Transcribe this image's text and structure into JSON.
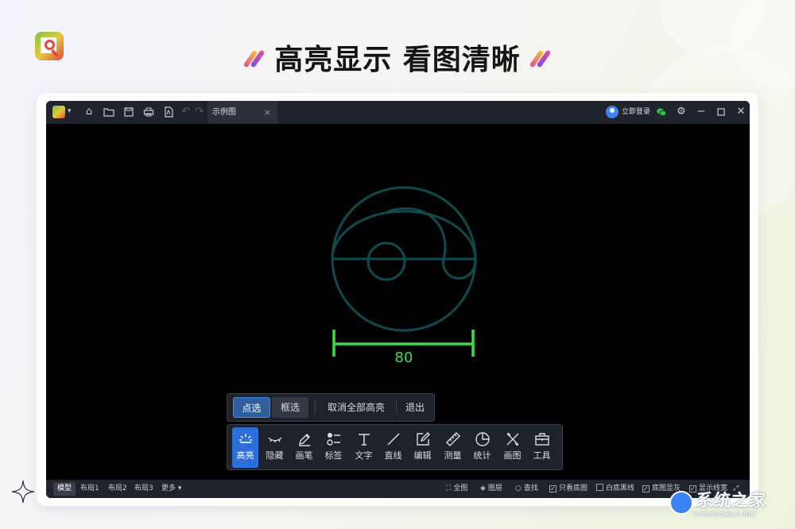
{
  "headline": "高亮显示 看图清晰",
  "titlebar": {
    "tab_label": "示例图",
    "tab_close": "×",
    "login_label": "立即登录",
    "icons": [
      "app-menu-icon",
      "home-icon",
      "open-folder-icon",
      "save-icon",
      "print-icon",
      "pdf-icon",
      "undo-icon",
      "redo-icon"
    ],
    "window_controls": [
      "settings-icon",
      "minimize-icon",
      "maximize-icon",
      "close-icon"
    ]
  },
  "drawing": {
    "dimension_value": "80",
    "line_color": "#0f4a4f",
    "dimension_color": "#3fdc4a"
  },
  "select_bar": {
    "point_select": "点选",
    "box_select": "框选",
    "cancel_all": "取消全部高亮",
    "exit": "退出"
  },
  "tools": [
    {
      "label": "高亮",
      "icon": "highlight-icon"
    },
    {
      "label": "隐藏",
      "icon": "hide-eye-icon"
    },
    {
      "label": "画笔",
      "icon": "pen-icon"
    },
    {
      "label": "标签",
      "icon": "tag-list-icon"
    },
    {
      "label": "文字",
      "icon": "text-icon"
    },
    {
      "label": "直线",
      "icon": "line-icon"
    },
    {
      "label": "编辑",
      "icon": "edit-icon"
    },
    {
      "label": "测量",
      "icon": "ruler-icon"
    },
    {
      "label": "统计",
      "icon": "pie-chart-icon"
    },
    {
      "label": "画图",
      "icon": "draw-tools-icon"
    },
    {
      "label": "工具",
      "icon": "toolbox-icon"
    }
  ],
  "statusbar": {
    "tabs": [
      "模型",
      "布局1",
      "布局2",
      "布局3",
      "更多"
    ],
    "fit_all": "全图",
    "layers": "图层",
    "find": "查找",
    "only_base": "只看底图",
    "white_base_black_line": "白底黑线",
    "base_gray": "底图显灰",
    "show_line_width": "显示线宽"
  },
  "watermark": {
    "brand": "系统之家",
    "sub": "XITONGZHIJIA.NET"
  },
  "colors": {
    "accent": "#2d6fd8",
    "titlebar": "#1f232b"
  }
}
